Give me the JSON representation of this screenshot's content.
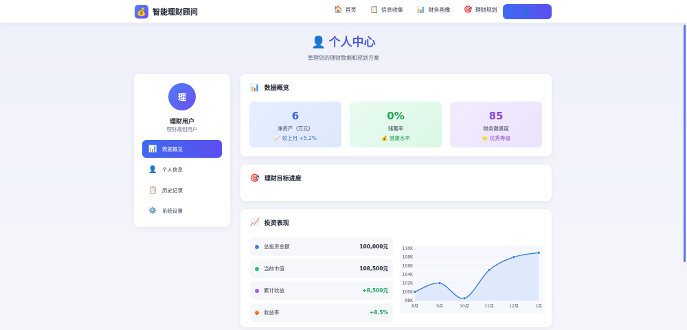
{
  "nav": {
    "brand_icon": "moneybag-icon",
    "brand_glyph": "💰",
    "brand_name": "智能理财顾问",
    "items": [
      {
        "label": "首页",
        "icon": "home-icon",
        "glyph": "🏠"
      },
      {
        "label": "信息收集",
        "icon": "clipboard-icon",
        "glyph": "📋"
      },
      {
        "label": "财务画像",
        "icon": "bar-chart-icon",
        "glyph": "📊"
      },
      {
        "label": "理财规划",
        "icon": "target-icon",
        "glyph": "🎯"
      }
    ],
    "user_icon": "user-icon",
    "user_glyph": "👤",
    "user_label": ""
  },
  "header": {
    "title_icon": "user-icon",
    "title_glyph": "👤",
    "title": "个人中心",
    "subtitle": "管理您的理财数据和规划方案"
  },
  "sidebar": {
    "avatar_text": "理",
    "user_name": "理财用户",
    "user_role": "理财规划用户",
    "items": [
      {
        "label": "数据概览",
        "icon": "bar-chart-icon",
        "glyph": "📊",
        "active": true
      },
      {
        "label": "个人信息",
        "icon": "user-icon",
        "glyph": "👤",
        "active": false
      },
      {
        "label": "历史记录",
        "icon": "clipboard-icon",
        "glyph": "📋",
        "active": false
      },
      {
        "label": "系统设置",
        "icon": "gear-icon",
        "glyph": "⚙️",
        "active": false
      }
    ]
  },
  "overview": {
    "title_icon": "bar-chart-icon",
    "title_glyph": "📊",
    "title": "数据概览",
    "stats": [
      {
        "value": "6",
        "label": "净资产（万元）",
        "note_glyph": "📈",
        "note": "较上月 +5.2%",
        "color": "#3a62d8"
      },
      {
        "value": "0%",
        "label": "储蓄率",
        "note_glyph": "💰",
        "note": "健康水平",
        "color": "#21a35a"
      },
      {
        "value": "85",
        "label": "财务健康度",
        "note_glyph": "⭐",
        "note": "优秀等级",
        "color": "#8a45d8"
      }
    ]
  },
  "goals": {
    "title_icon": "target-icon",
    "title_glyph": "🎯",
    "title": "理财目标进度"
  },
  "invest": {
    "title_icon": "line-chart-icon",
    "title_glyph": "📈",
    "title": "投资表现",
    "metrics": [
      {
        "label": "总投资金额",
        "value": "100,000元",
        "dot": "#3b82f6",
        "positive": false
      },
      {
        "label": "当前市值",
        "value": "108,500元",
        "dot": "#22c55e",
        "positive": false
      },
      {
        "label": "累计收益",
        "value": "+8,500元",
        "dot": "#a855f7",
        "positive": true
      },
      {
        "label": "收益率",
        "value": "+8.5%",
        "dot": "#f97316",
        "positive": true
      }
    ]
  },
  "chart_data": {
    "type": "area",
    "categories": [
      "8月",
      "9月",
      "10月",
      "11月",
      "12月",
      "1月"
    ],
    "values": [
      100000,
      102000,
      98500,
      105000,
      108000,
      109000
    ],
    "ylim": [
      98000,
      110000
    ],
    "yticks": [
      98000,
      100000,
      102000,
      104000,
      106000,
      108000,
      110000
    ],
    "ytick_labels": [
      "98K",
      "100K",
      "102K",
      "104K",
      "106K",
      "108K",
      "110K"
    ],
    "grid": true,
    "line_color": "#3b7be0",
    "fill_color": "#dbe6fb"
  }
}
